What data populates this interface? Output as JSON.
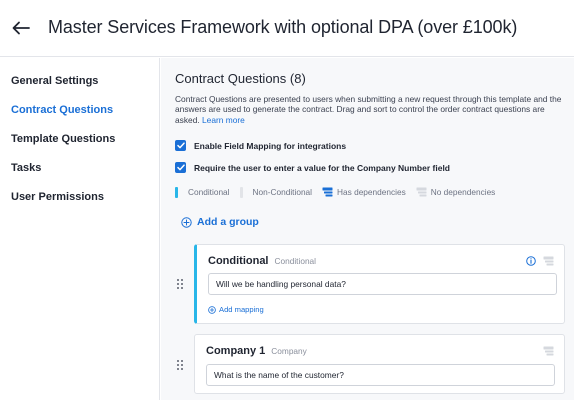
{
  "header": {
    "title": "Master Services Framework with optional DPA (over £100k)"
  },
  "sidebar": {
    "items": [
      {
        "label": "General Settings",
        "active": false
      },
      {
        "label": "Contract Questions",
        "active": true
      },
      {
        "label": "Template Questions",
        "active": false
      },
      {
        "label": "Tasks",
        "active": false
      },
      {
        "label": "User Permissions",
        "active": false
      }
    ]
  },
  "main": {
    "section_title": "Contract Questions (8)",
    "description": "Contract Questions are presented to users when submitting a new request through this template and the answers are used to generate the contract. Drag and sort to control the order contract questions are asked.",
    "learn_more": "Learn more",
    "checkboxes": [
      {
        "label": "Enable Field Mapping for integrations",
        "checked": true
      },
      {
        "label": "Require the user to enter a value for the Company Number field",
        "checked": true
      }
    ],
    "legend": {
      "conditional": "Conditional",
      "non_conditional": "Non-Conditional",
      "has_dependencies": "Has dependencies",
      "no_dependencies": "No dependencies"
    },
    "add_group_label": "Add a group",
    "questions": [
      {
        "name": "Conditional",
        "type": "Conditional",
        "value": "Will we be handling personal data?",
        "add_mapping": "Add mapping"
      },
      {
        "name": "Company 1",
        "type": "Company",
        "value": "What is the name of the customer?"
      }
    ]
  },
  "colors": {
    "accent": "#1a6fd6",
    "conditional": "#29b6e8",
    "text": "#1f2430",
    "muted": "#8a8f9c",
    "background": "#f7f8fa"
  },
  "icons": {
    "back": "arrow-left-icon",
    "checkbox": "checkmark-icon",
    "add_group": "plus-circle-icon",
    "drag": "drag-handle-icon",
    "info": "info-icon",
    "dependencies": "stack-icon"
  }
}
